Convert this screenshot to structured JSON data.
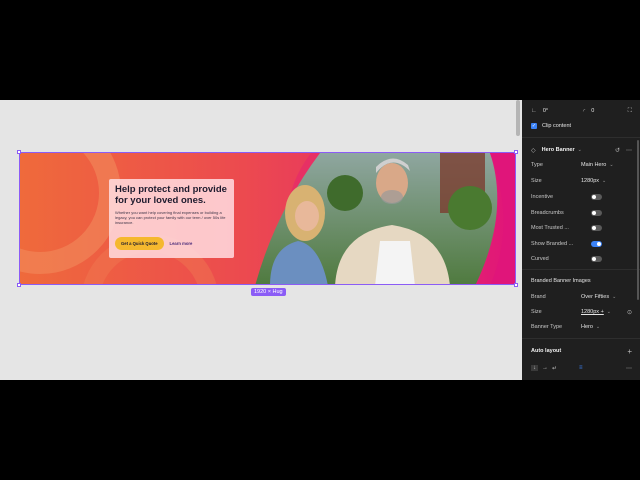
{
  "canvas": {
    "banner": {
      "headline": "Help protect and provide for your loved ones.",
      "body": "Whether you want help covering final expenses or building a legacy, you can protect your family with our term / over 50s life insurance.",
      "cta_label": "Get a Quick Quote",
      "link_label": "Learn more"
    },
    "size_badge": "1920 × Hug"
  },
  "panel": {
    "rotation": "0°",
    "radius": "0",
    "clip_content_label": "Clip content",
    "component_title": "Hero Banner",
    "props": [
      {
        "label": "Type",
        "value": "Main Hero"
      },
      {
        "label": "Size",
        "value": "1280px"
      }
    ],
    "toggles": [
      {
        "label": "Incentive",
        "on": false
      },
      {
        "label": "Breadcrumbs",
        "on": false
      },
      {
        "label": "Most Trusted ...",
        "on": false
      },
      {
        "label": "Show Branded ...",
        "on": true
      },
      {
        "label": "Curved",
        "on": false
      }
    ],
    "branded_section_title": "Branded Banner Images",
    "branded_props": [
      {
        "label": "Brand",
        "value": "Over Fifties"
      },
      {
        "label": "Size",
        "value": "1280px +"
      },
      {
        "label": "Banner Type",
        "value": "Hero"
      }
    ],
    "auto_layout_title": "Auto layout"
  },
  "colors": {
    "accent": "#8b5cf6",
    "toggle_on": "#3b82f6",
    "cta": "#f5b82e"
  }
}
